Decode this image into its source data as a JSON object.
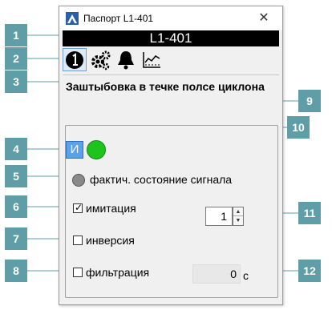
{
  "window": {
    "title": "Паспорт L1-401",
    "close_glyph": "✕"
  },
  "header": {
    "tag": "L1-401"
  },
  "toolbar": {
    "items": [
      {
        "icon": "info-circle-icon"
      },
      {
        "icon": "gears-icon"
      },
      {
        "icon": "bell-icon"
      },
      {
        "icon": "trend-chart-icon"
      }
    ]
  },
  "object": {
    "name": "Заштыбовка в течке полсе циклона"
  },
  "mode": {
    "letter": "И"
  },
  "signal": {
    "label": "фактич. состояние сигнала"
  },
  "options": {
    "imitation": {
      "label": "имитация",
      "checked": true,
      "check_glyph": "✓"
    },
    "inversion": {
      "label": "инверсия",
      "checked": false
    },
    "filtering": {
      "label": "фильтрация",
      "checked": false
    }
  },
  "spinner": {
    "value": "1",
    "up": "▲",
    "down": "▼"
  },
  "filter": {
    "value": "0",
    "unit": "с"
  },
  "callouts": [
    "1",
    "2",
    "3",
    "4",
    "5",
    "6",
    "7",
    "8",
    "9",
    "10",
    "11",
    "12"
  ],
  "colors": {
    "callout": "#5f9ea6",
    "led_on": "#1ec41e",
    "mode_button": "#5aa0ea",
    "header_bg": "#000000"
  }
}
